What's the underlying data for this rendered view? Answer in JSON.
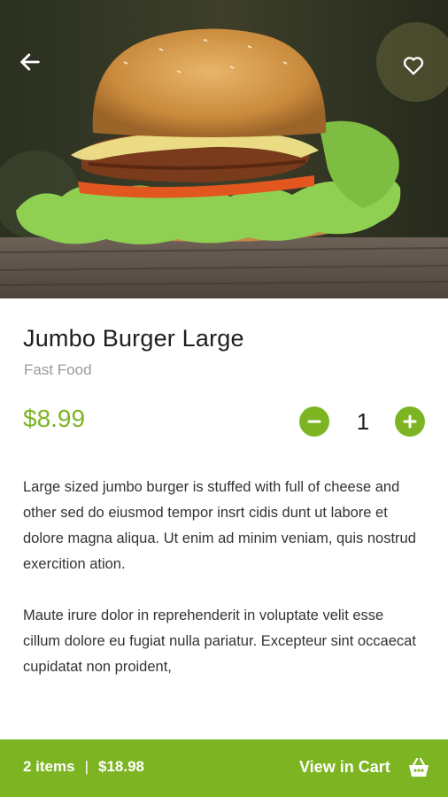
{
  "product": {
    "name": "Jumbo Burger Large",
    "category": "Fast Food",
    "price": "$8.99",
    "quantity": "1",
    "description": [
      "Large sized jumbo burger is stuffed with full of cheese and other sed do eiusmod tempor insrt cidis dunt ut labore et dolore magna aliqua. Ut enim ad minim veniam, quis nostrud exercition ation.",
      "Maute irure dolor in reprehenderit in voluptate velit esse cillum dolore eu fugiat nulla pariatur. Excepteur sint occaecat cupidatat non proident,"
    ]
  },
  "cart": {
    "items": "2 items",
    "separator": "|",
    "total": "$18.98",
    "cta": "View in Cart"
  },
  "colors": {
    "accent": "#7cb521"
  }
}
